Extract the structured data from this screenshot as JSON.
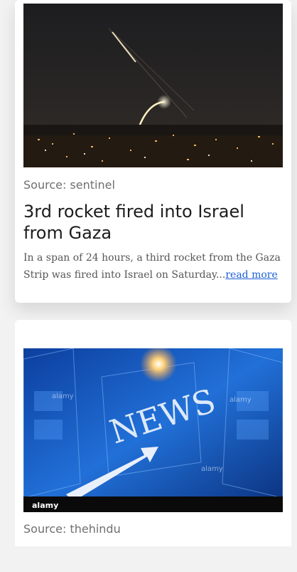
{
  "articles": [
    {
      "image_alt": "Rocket streaks over city skyline at night",
      "source": "Source: sentinel",
      "title": "3rd rocket fired into Israel from Gaza",
      "summary": "In a span of 24 hours, a third rocket from the Gaza Strip was fired into Israel on Saturday...",
      "read_more": "read more"
    },
    {
      "image_alt": "NEWS graphic with arrow and screens",
      "image_text": "NEWS",
      "watermark": "alamy",
      "source": "Source: thehindu"
    }
  ]
}
